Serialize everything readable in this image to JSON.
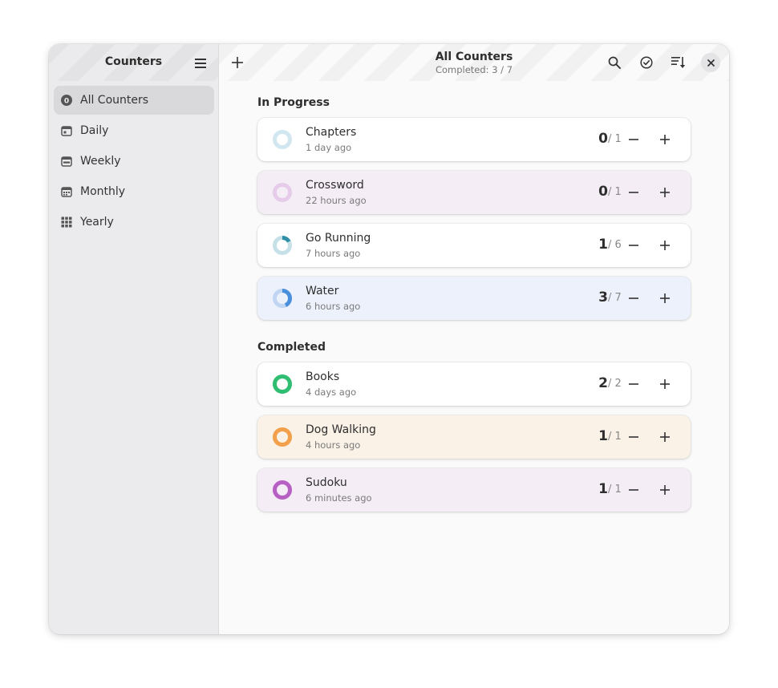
{
  "sidebar": {
    "title": "Counters",
    "items": [
      {
        "label": "All Counters",
        "icon": "all-counters-icon",
        "active": true
      },
      {
        "label": "Daily",
        "icon": "calendar-day-icon"
      },
      {
        "label": "Weekly",
        "icon": "calendar-week-icon"
      },
      {
        "label": "Monthly",
        "icon": "calendar-month-icon"
      },
      {
        "label": "Yearly",
        "icon": "grid-year-icon"
      }
    ]
  },
  "header": {
    "title": "All Counters",
    "subtitle": "Completed: 3 / 7"
  },
  "sections": [
    {
      "label": "In Progress",
      "counters": [
        {
          "name": "Chapters",
          "time": "1 day ago",
          "count": "0",
          "goal": "/ 1",
          "progress": 0,
          "color": "#5aa9c4",
          "bg": "#ffffff"
        },
        {
          "name": "Crossword",
          "time": "22 hours ago",
          "count": "0",
          "goal": "/ 1",
          "progress": 0,
          "color": "#c678c9",
          "bg": "#f4edf6"
        },
        {
          "name": "Go Running",
          "time": "7 hours ago",
          "count": "1",
          "goal": "/ 6",
          "progress": 0.1667,
          "color": "#2f8fa8",
          "bg": "#ffffff"
        },
        {
          "name": "Water",
          "time": "6 hours ago",
          "count": "3",
          "goal": "/ 7",
          "progress": 0.4286,
          "color": "#4a8fdc",
          "bg": "#edf1fb"
        }
      ]
    },
    {
      "label": "Completed",
      "counters": [
        {
          "name": "Books",
          "time": "4 days ago",
          "count": "2",
          "goal": "/ 2",
          "progress": 1,
          "color": "#2fbd71",
          "bg": "#ffffff"
        },
        {
          "name": "Dog Walking",
          "time": "4 hours ago",
          "count": "1",
          "goal": "/ 1",
          "progress": 1,
          "color": "#f3a04a",
          "bg": "#faf1e7"
        },
        {
          "name": "Sudoku",
          "time": "6 minutes ago",
          "count": "1",
          "goal": "/ 1",
          "progress": 1,
          "color": "#b760c4",
          "bg": "#f4edf6"
        }
      ]
    }
  ]
}
